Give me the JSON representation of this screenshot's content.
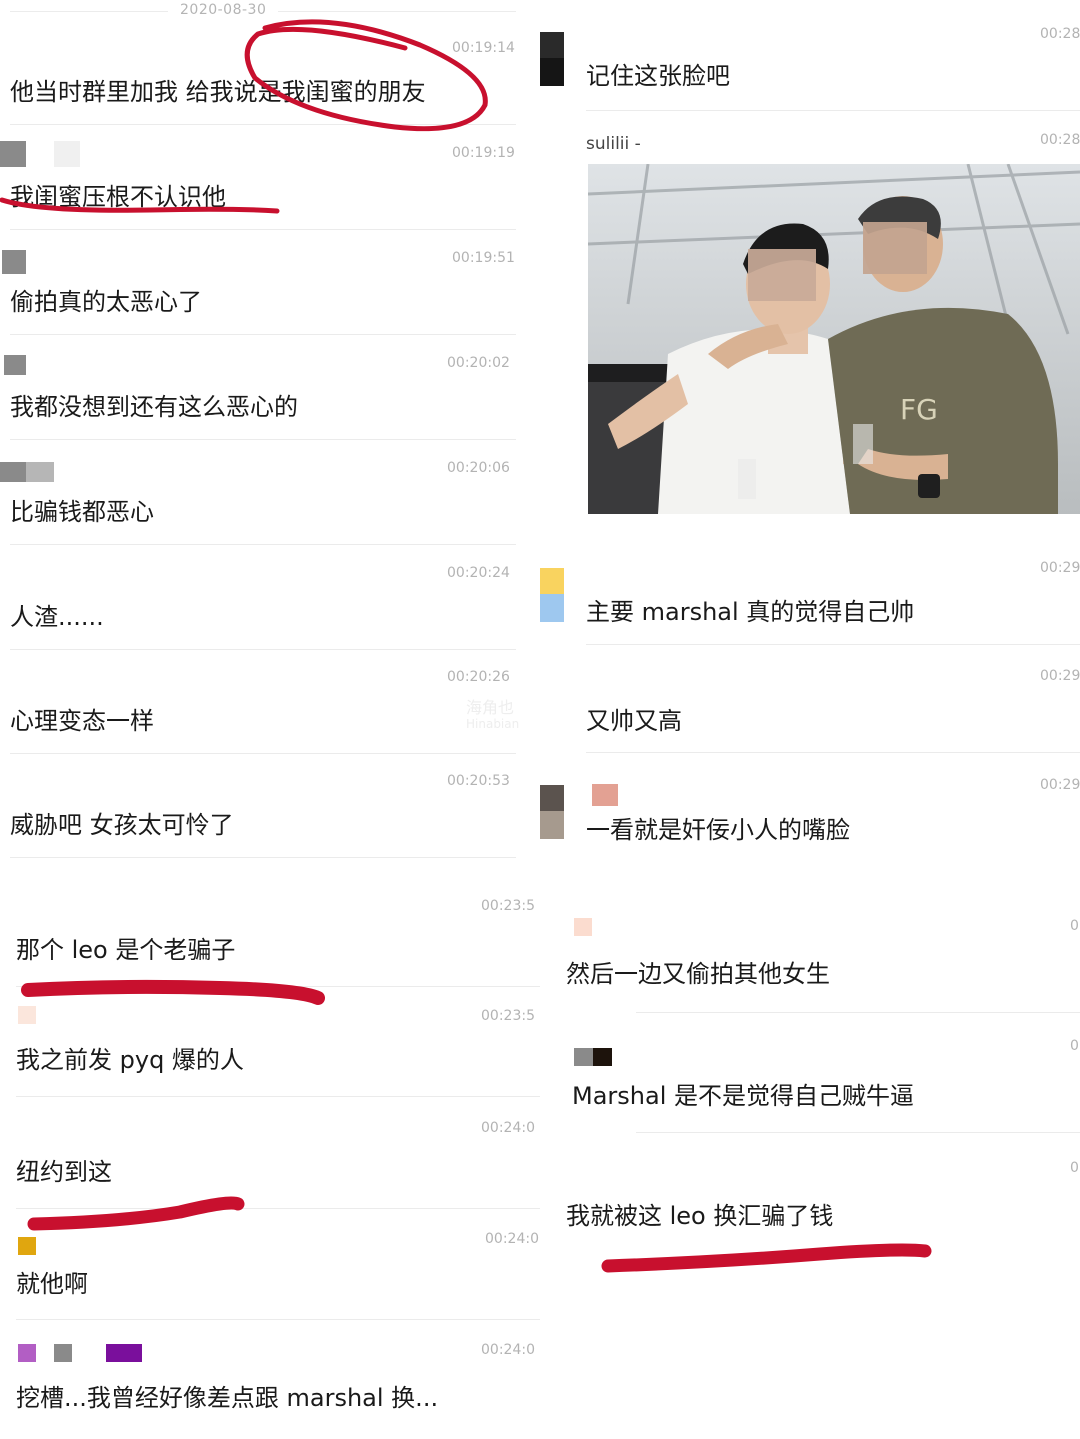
{
  "left": {
    "date": "2020-08-30",
    "messages": [
      {
        "time": "00:19:14",
        "text": "他当时群里加我 给我说是我闺蜜的朋友"
      },
      {
        "time": "00:19:19",
        "text": "我闺蜜压根不认识他"
      },
      {
        "time": "00:19:51",
        "text": "偷拍真的太恶心了"
      },
      {
        "time": "00:20:02",
        "text": "我都没想到还有这么恶心的"
      },
      {
        "time": "00:20:06",
        "text": "比骗钱都恶心"
      },
      {
        "time": "00:20:24",
        "text": "人渣......"
      },
      {
        "time": "00:20:26",
        "text": "心理变态一样"
      },
      {
        "time": "00:20:53",
        "text": "威胁吧 女孩太可怜了"
      },
      {
        "time": "00:23:5",
        "text": "那个 leo 是个老骗子"
      },
      {
        "time": "00:23:5",
        "text": "我之前发 pyq 爆的人"
      },
      {
        "time": "00:24:0",
        "text": "纽约到这"
      },
      {
        "time": "00:24:0",
        "text": "就他啊"
      },
      {
        "time": "00:24:0",
        "text": "挖槽...我曾经好像差点跟 marshal 换..."
      }
    ]
  },
  "right": {
    "sender_name": "sulilii -",
    "messages": [
      {
        "time": "00:28",
        "text": "记住这张脸吧"
      },
      {
        "time": "00:28",
        "text": ""
      },
      {
        "time": "00:29",
        "text": "主要 marshal 真的觉得自己帅"
      },
      {
        "time": "00:29",
        "text": "又帅又高"
      },
      {
        "time": "00:29",
        "text": "一看就是奸佞小人的嘴脸"
      },
      {
        "time": "0",
        "text": "然后一边又偷拍其他女生"
      },
      {
        "time": "0",
        "text": "Marshal 是不是觉得自己贼牛逼"
      },
      {
        "time": "0",
        "text": "我就被这 leo 换汇骗了钱"
      }
    ],
    "photo": {
      "shirt_print": "FG"
    }
  },
  "watermark": {
    "line1": "海角也",
    "line2": "Hinabian"
  },
  "colors": {
    "annotation_red": "#c8102e",
    "timestamp": "#b3b3b3",
    "divider": "#ebebeb",
    "text": "#1a1a1a"
  }
}
